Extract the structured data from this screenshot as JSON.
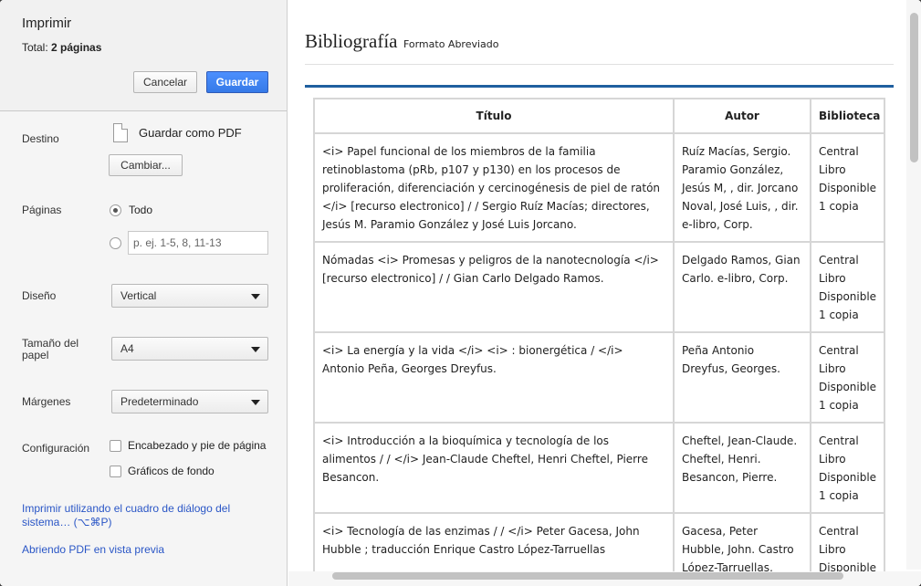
{
  "sidebar": {
    "title": "Imprimir",
    "total_label": "Total:",
    "total_value": "2 páginas",
    "cancel_label": "Cancelar",
    "save_label": "Guardar",
    "destination": {
      "label": "Destino",
      "value": "Guardar como PDF",
      "change_label": "Cambiar...",
      "icon": "pdf-file-icon"
    },
    "pages": {
      "label": "Páginas",
      "option_all": "Todo",
      "custom_placeholder": "p. ej. 1-5, 8, 11-13"
    },
    "layout": {
      "label": "Diseño",
      "value": "Vertical"
    },
    "paper_size": {
      "label": "Tamaño del papel",
      "value": "A4"
    },
    "margins": {
      "label": "Márgenes",
      "value": "Predeterminado"
    },
    "options": {
      "label": "Configuración",
      "header_footer": "Encabezado y pie de página",
      "background_graphics": "Gráficos de fondo"
    },
    "system_dialog_link": "Imprimir utilizando el cuadro de diálogo del sistema… (⌥⌘P)",
    "preview_link": "Abriendo PDF en vista previa"
  },
  "preview": {
    "title": "Bibliografía",
    "subtitle": "Formato Abreviado",
    "columns": [
      "Título",
      "Autor",
      "Biblioteca"
    ],
    "rows": [
      {
        "titulo": "<i> Papel funcional de los miembros de la familia retinoblastoma (pRb, p107 y p130) en los procesos de proliferación, diferenciación y cercinogénesis de piel de ratón </i> [recurso electronico] / / Sergio Ruíz Macías; directores, Jesús M. Paramio González y José Luis Jorcano.",
        "autor": "Ruíz Macías, Sergio. Paramio González, Jesús M, , dir. Jorcano Noval, José Luis, , dir. e-libro, Corp.",
        "biblioteca": [
          "Central",
          "Libro",
          "Disponible",
          "1 copia"
        ]
      },
      {
        "titulo": "Nómadas <i> Promesas y peligros de la nanotecnología </i> [recurso electronico] / / Gian Carlo Delgado Ramos.",
        "autor": "Delgado Ramos, Gian Carlo. e-libro, Corp.",
        "biblioteca": [
          "Central",
          "Libro",
          "Disponible",
          "1 copia"
        ]
      },
      {
        "titulo": "<i> La energía y la vida </i> <i> : bionergética / </i> Antonio Peña, Georges Dreyfus.",
        "autor": "Peña Antonio Dreyfus, Georges.",
        "biblioteca": [
          "Central",
          "Libro",
          "Disponible",
          "1 copia"
        ]
      },
      {
        "titulo": "<i> Introducción a la bioquímica y tecnología de los alimentos / / </i> Jean-Claude Cheftel, Henri Cheftel, Pierre Besancon.",
        "autor": "Cheftel, Jean-Claude. Cheftel, Henri. Besancon, Pierre.",
        "biblioteca": [
          "Central",
          "Libro",
          "Disponible",
          "1 copia"
        ]
      },
      {
        "titulo": "<i> Tecnología de las enzimas / / </i> Peter Gacesa, John Hubble ; traducción Enrique Castro López-Tarruellas",
        "autor": "Gacesa, Peter Hubble, John. Castro López-Tarruellas, Enrique, tr.",
        "biblioteca": [
          "Central",
          "Libro",
          "Disponible"
        ]
      }
    ]
  }
}
